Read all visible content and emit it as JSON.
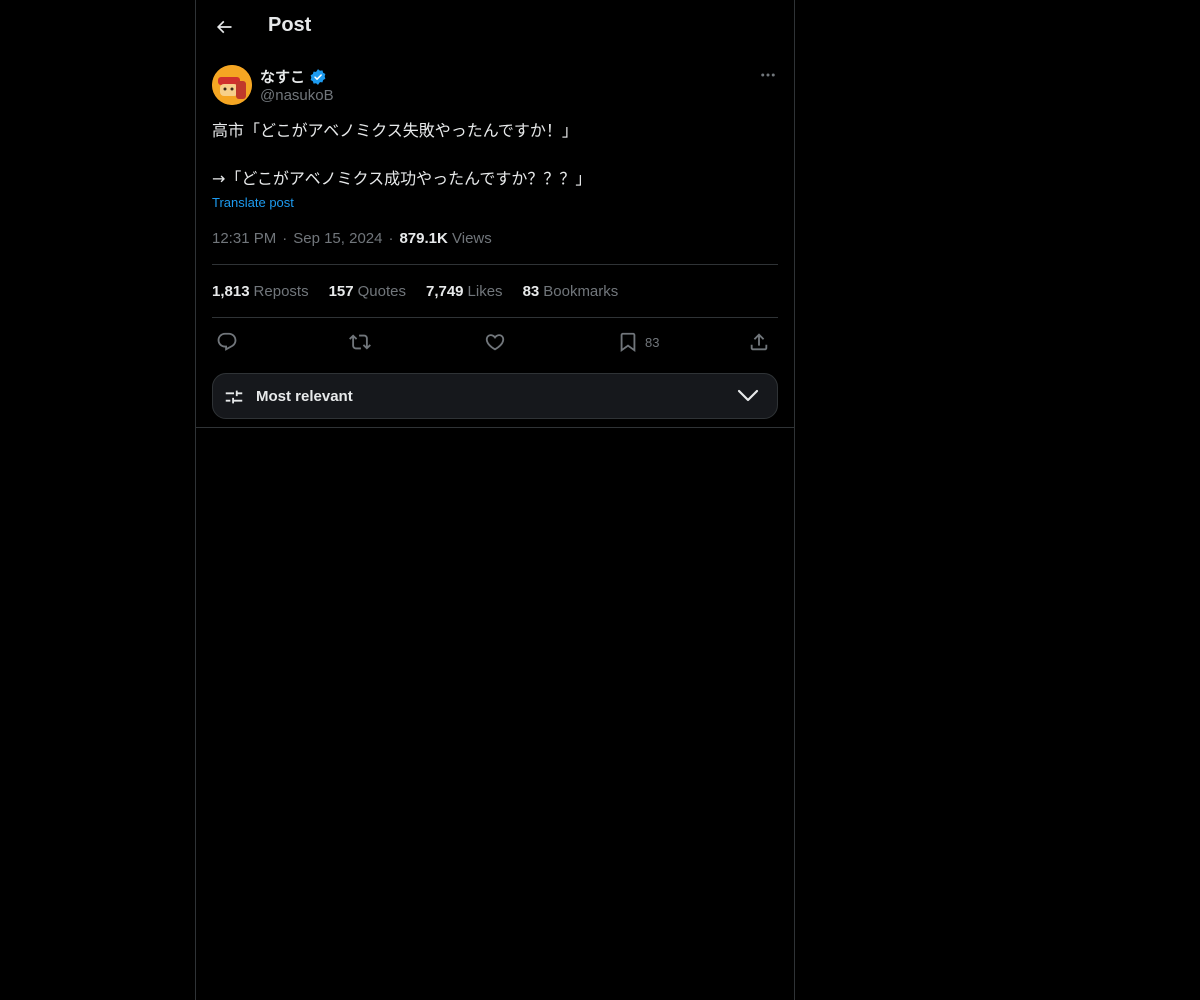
{
  "header": {
    "title": "Post"
  },
  "author": {
    "display_name": "なすこ",
    "handle": "@nasukoB",
    "verified": true
  },
  "post": {
    "text": "高市「どこがアベノミクス失敗やったんですか！」\n\n→「どこがアベノミクス成功やったんですか？？？」",
    "translate_label": "Translate post",
    "time": "12:31 PM",
    "date": "Sep 15, 2024",
    "views_count": "879.1K",
    "views_label": "Views",
    "separator": "·"
  },
  "stats": {
    "reposts": {
      "count": "1,813",
      "label": "Reposts"
    },
    "quotes": {
      "count": "157",
      "label": "Quotes"
    },
    "likes": {
      "count": "7,749",
      "label": "Likes"
    },
    "bookmarks": {
      "count": "83",
      "label": "Bookmarks"
    }
  },
  "actions": {
    "bookmark_count": "83"
  },
  "sort": {
    "label": "Most relevant"
  },
  "colors": {
    "accent": "#1d9bf0",
    "muted": "#71767b",
    "text": "#e7e9ea",
    "border": "#2f3336"
  },
  "icons": [
    "back-arrow-icon",
    "verified-badge-icon",
    "more-icon",
    "reply-icon",
    "repost-icon",
    "like-icon",
    "bookmark-icon",
    "share-icon",
    "sort-sliders-icon",
    "chevron-down-icon"
  ]
}
